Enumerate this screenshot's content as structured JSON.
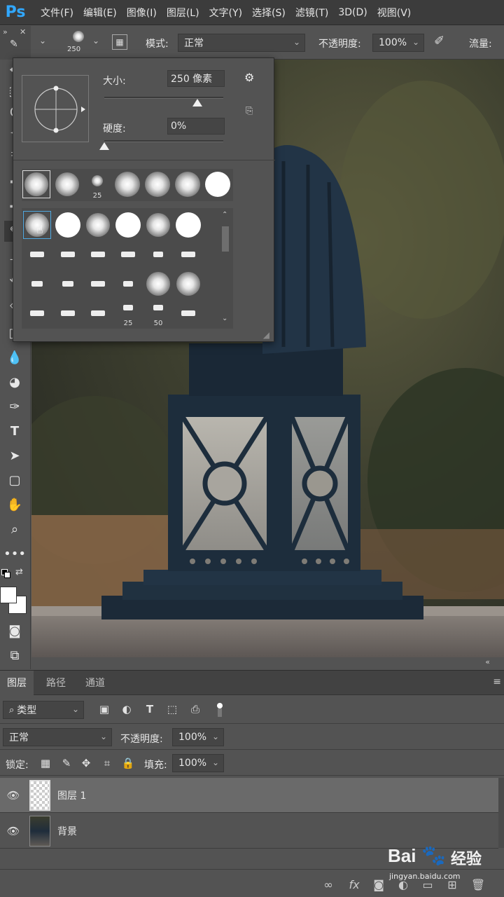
{
  "app": {
    "logo": "Ps"
  },
  "menu": [
    "文件(F)",
    "编辑(E)",
    "图像(I)",
    "图层(L)",
    "文字(Y)",
    "选择(S)",
    "滤镜(T)",
    "3D(D)",
    "视图(V)"
  ],
  "options": {
    "brush_size": "250",
    "mode_label": "模式:",
    "mode_value": "正常",
    "opacity_label": "不透明度:",
    "opacity_value": "100%",
    "flow_label": "流量:"
  },
  "brush_popup": {
    "size_label": "大小:",
    "size_value": "250 像素",
    "hardness_label": "硬度:",
    "hardness_value": "0%",
    "size_slider_fraction": 0.78,
    "hardness_slider_fraction": 0.0,
    "row1_labels": [
      "",
      "",
      "25",
      "",
      "",
      "",
      ""
    ],
    "grid_labels": [
      "",
      "",
      "",
      "",
      "",
      "",
      "",
      "",
      "",
      "",
      "",
      "",
      "",
      "",
      "",
      "",
      "",
      "",
      "",
      "",
      "",
      "",
      "25",
      "50",
      ""
    ]
  },
  "panel": {
    "tabs": [
      "图层",
      "路径",
      "通道"
    ],
    "filter_kind": "类型",
    "blend_mode": "正常",
    "opacity_label": "不透明度:",
    "opacity_value": "100%",
    "lock_label": "锁定:",
    "fill_label": "填充:",
    "fill_value": "100%",
    "layers": [
      {
        "name": "图层 1",
        "selected": true
      },
      {
        "name": "背景",
        "selected": false
      }
    ]
  },
  "watermark": {
    "brand": "Bai",
    "brand_cn": "经验",
    "url": "jingyan.baidu.com"
  },
  "colors": {
    "accent": "#31a8ff",
    "panel_bg": "#535353",
    "menu_bg": "#3c3c3c"
  }
}
